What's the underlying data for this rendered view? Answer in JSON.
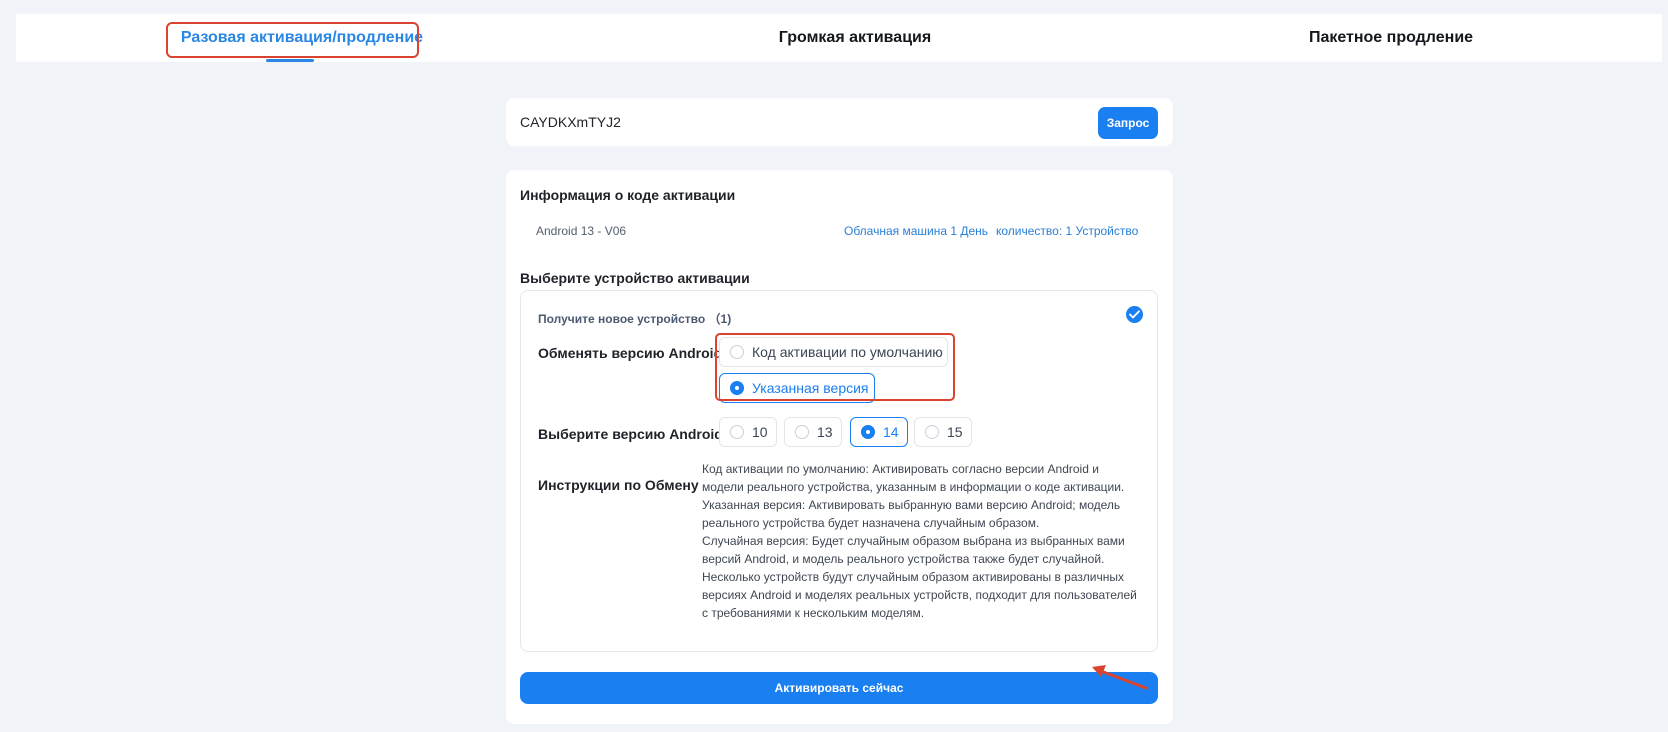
{
  "tabs": [
    {
      "label": "Разовая активация/продление",
      "active": true
    },
    {
      "label": "Громкая активация",
      "active": false
    },
    {
      "label": "Пакетное продление",
      "active": false
    }
  ],
  "query": {
    "code_value": "CAYDKXmTYJ2",
    "button_label": "Запрос"
  },
  "activation_info": {
    "title": "Информация о коде активации",
    "version": "Android 13 - V06",
    "cloud_machine": "Облачная машина 1 День",
    "quantity": "количество: 1 Устройство"
  },
  "device_select": {
    "title": "Выберите устройство активации",
    "new_device_label": "Получите новое устройство （1)",
    "new_device_checked": true,
    "change_version_label": "Обменять версию Android",
    "change_options": [
      {
        "label": "Код активации по умолчанию",
        "selected": false
      },
      {
        "label": "Указанная версия",
        "selected": true
      }
    ],
    "select_version_label": "Выберите версию Android",
    "versions": [
      {
        "label": "10",
        "selected": false
      },
      {
        "label": "13",
        "selected": false
      },
      {
        "label": "14",
        "selected": true
      },
      {
        "label": "15",
        "selected": false
      }
    ],
    "instructions_label": "Инструкции по Обмену",
    "instructions_text": "Код активации по умолчанию: Активировать согласно версии Android и\nмодели реального устройства, указанным в информации о коде активации.\nУказанная версия: Активировать выбранную вами версию Android; модель\nреального устройства будет назначена случайным образом.\nСлучайная версия: Будет случайным образом выбрана из выбранных вами\nверсий Android, и модель реального устройства также будет случайной.\nНесколько устройств будут случайным образом активированы в различных\nверсиях Android и моделях реальных устройств, подходит для пользователей\nс требованиями к нескольким моделям."
  },
  "activate_button_label": "Активировать сейчас",
  "colors": {
    "accent": "#1a7ff0",
    "annotation": "#d9432f",
    "background": "#f0f3f7"
  }
}
